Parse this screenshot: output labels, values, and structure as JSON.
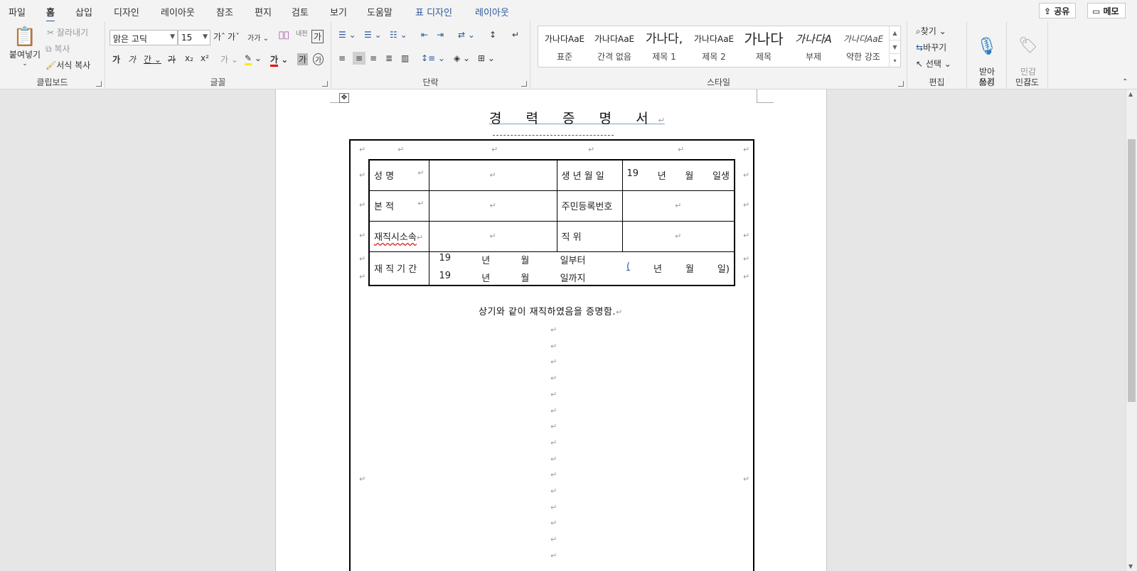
{
  "tabs": {
    "file": "파일",
    "home": "홈",
    "insert": "삽입",
    "design": "디자인",
    "layout": "레이아웃",
    "references": "참조",
    "mailings": "편지",
    "review": "검토",
    "view": "보기",
    "help": "도움말",
    "table_design": "표 디자인",
    "table_layout": "레이아웃"
  },
  "top_right": {
    "share": "공유",
    "comments": "메모"
  },
  "clipboard": {
    "paste": "붙여넣기",
    "cut": "잘라내기",
    "copy": "복사",
    "format_painter": "서식 복사",
    "label": "클립보드"
  },
  "font": {
    "name": "맑은 고딕",
    "size": "15",
    "label": "글꼴"
  },
  "paragraph": {
    "label": "단락"
  },
  "styles": {
    "label": "스타일",
    "items": [
      {
        "preview": "가나다AaE",
        "name": "표준"
      },
      {
        "preview": "가나다AaE",
        "name": "간격 없음"
      },
      {
        "preview": "가나다,",
        "name": "제목 1"
      },
      {
        "preview": "가나다AaE",
        "name": "제목 2"
      },
      {
        "preview": "가나다",
        "name": "제목"
      },
      {
        "preview": "가나다A",
        "name": "부제"
      },
      {
        "preview": "가나다AaE",
        "name": "약한 강조"
      }
    ]
  },
  "editing": {
    "find": "찾기",
    "replace": "바꾸기",
    "select": "선택",
    "label": "편집"
  },
  "voice": {
    "dictate": "받아\n쓰기",
    "label": "음성"
  },
  "sensitivity": {
    "button": "민감\n도",
    "label": "민감도"
  },
  "document": {
    "title": "경 력 증 명 서",
    "table": {
      "name_label": "성 명",
      "birth_label": "생 년 월 일",
      "birth_value": [
        "19",
        "년",
        "월",
        "일생"
      ],
      "domicile_label": "본 적",
      "id_label": "주민등록번호",
      "company_label": "재직시소속",
      "position_label": "직 위",
      "period_label": "재 직 기 간",
      "period_from": [
        "19",
        "년",
        "월",
        "일부터"
      ],
      "period_to": [
        "19",
        "년",
        "월",
        "일까지"
      ],
      "duration": [
        "(",
        "년",
        "월",
        "일)"
      ]
    },
    "closing": "상기와 같이 재직하였음을 증명함."
  }
}
